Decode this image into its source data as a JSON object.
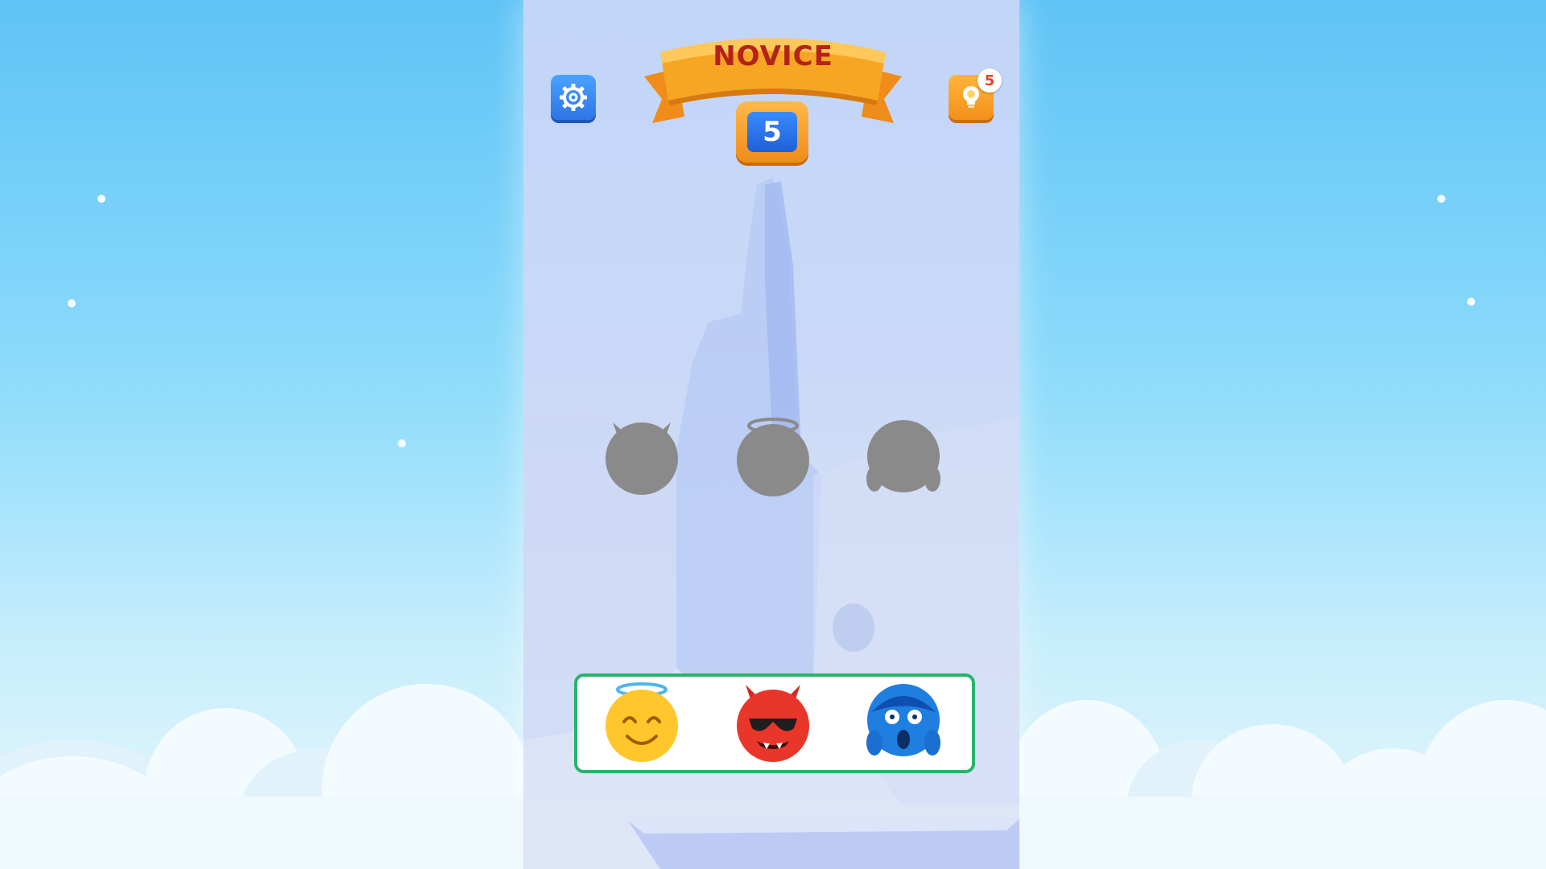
{
  "level": {
    "rank_title": "NOVICE",
    "number": "5"
  },
  "hints": {
    "count": "5"
  },
  "target_slots": [
    {
      "silhouette": "devil-horns-silhouette"
    },
    {
      "silhouette": "halo-silhouette"
    },
    {
      "silhouette": "screaming-hands-silhouette"
    }
  ],
  "emoji_tray": [
    {
      "emoji": "smiling-face-with-halo"
    },
    {
      "emoji": "devil-with-sunglasses"
    },
    {
      "emoji": "face-screaming-in-fear"
    }
  ],
  "colors": {
    "tray_border": "#27b46a",
    "banner": "#f6a623",
    "banner_text": "#b4231a",
    "silhouette": "#8a8a8a"
  }
}
